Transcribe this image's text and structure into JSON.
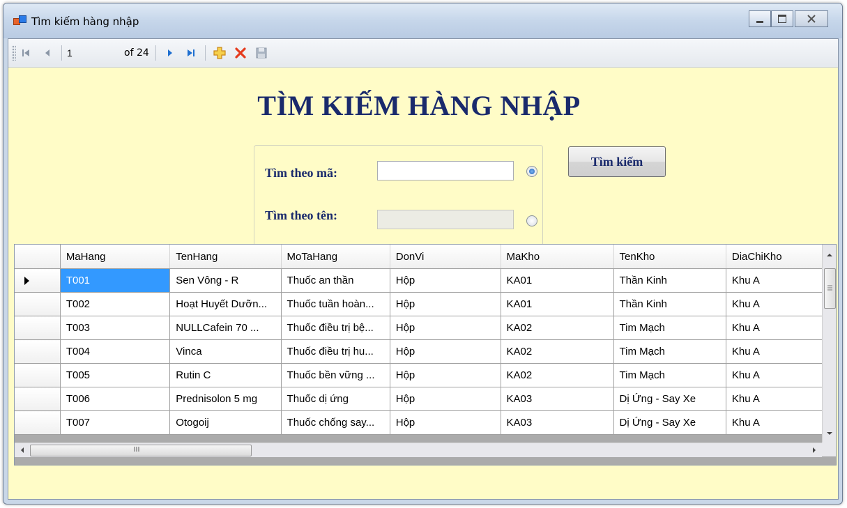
{
  "window": {
    "title": "Tìm kiếm hàng nhập"
  },
  "navigator": {
    "position": "1",
    "count_label": "of 24"
  },
  "form": {
    "heading": "TÌM KIẾM HÀNG NHẬP",
    "by_code_label": "Tìm theo mã:",
    "by_name_label": "Tìm theo tên:",
    "by_code_value": "",
    "by_name_value": "",
    "by_code_selected": true,
    "search_button": "Tìm kiếm"
  },
  "grid": {
    "columns": [
      "MaHang",
      "TenHang",
      "MoTaHang",
      "DonVi",
      "MaKho",
      "TenKho",
      "DiaChiKho"
    ],
    "rows": [
      [
        "T001",
        "Sen Vông - R",
        "Thuốc an thần",
        "Hộp",
        "KA01",
        "Thần Kinh",
        "Khu A"
      ],
      [
        "T002",
        "Hoạt Huyết Dưỡn...",
        "Thuốc tuần hoàn...",
        "Hộp",
        "KA01",
        "Thần Kinh",
        "Khu A"
      ],
      [
        "T003",
        "NULLCafein 70 ...",
        "Thuốc điều trị bệ...",
        "Hộp",
        "KA02",
        "Tim Mạch",
        "Khu A"
      ],
      [
        "T004",
        "Vinca",
        "Thuốc điều trị hu...",
        "Hộp",
        "KA02",
        "Tim Mạch",
        "Khu A"
      ],
      [
        "T005",
        "Rutin C",
        "Thuốc bền vững ...",
        "Hộp",
        "KA02",
        "Tim Mạch",
        "Khu A"
      ],
      [
        "T006",
        "Prednisolon 5 mg",
        "Thuốc dị ứng",
        "Hộp",
        "KA03",
        "Dị Ứng - Say Xe",
        "Khu A"
      ],
      [
        "T007",
        "Otogoij",
        "Thuốc chống say...",
        "Hộp",
        "KA03",
        "Dị Ứng - Say Xe",
        "Khu A"
      ]
    ],
    "scroll_grip": "III"
  },
  "colors": {
    "heading": "#1a2a6c",
    "form_background": "#fffcc7",
    "selection": "#3399ff",
    "delete_icon": "#e53b1e",
    "add_icon": "#f0a020",
    "nav_icon": "#1e6fd0"
  },
  "icons": [
    "move-first-icon",
    "move-previous-icon",
    "move-next-icon",
    "move-last-icon",
    "add-new-icon",
    "delete-icon",
    "save-icon"
  ]
}
